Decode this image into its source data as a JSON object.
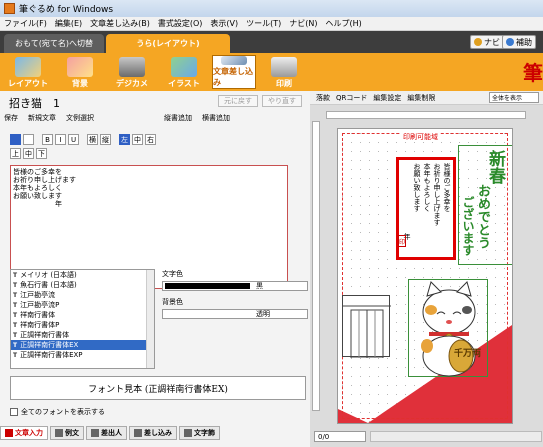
{
  "window": {
    "title": "筆ぐるめ for Windows"
  },
  "menu": [
    "ファイル(F)",
    "編集(E)",
    "文章差し込み(B)",
    "書式設定(O)",
    "表示(V)",
    "ツール(T)",
    "ナビ(N)",
    "ヘルプ(H)"
  ],
  "tabs": {
    "front": "おもて(宛て名)へ切替",
    "back": "うら(レイアウト)"
  },
  "help_buttons": {
    "navi": "ナビ",
    "assist": "補助"
  },
  "ribbon": [
    "レイアウト",
    "背景",
    "デジカメ",
    "イラスト",
    "文章差し込み",
    "印刷"
  ],
  "brand": "筆",
  "editor": {
    "title": "招き猫　1",
    "undo": "元に戻す",
    "redo": "やり直す",
    "toolbar": {
      "save": "保存",
      "new_text": "新規文章",
      "select_text": "文例選択",
      "add_vertical": "縦書追加",
      "add_horizontal": "横書追加"
    },
    "format_row1": [
      "B",
      "I",
      "U",
      "横",
      "縦",
      "左",
      "中",
      "右"
    ],
    "format_row2": [
      "上",
      "中",
      "下"
    ],
    "body_text": "皆様のご多幸を\nお祈り申し上げます\n本年もよろしく\nお願い致します\n　　　　　　年",
    "fonts": [
      "メイリオ (日本語)",
      "魚石行書 (日本語)",
      "江戸勘亭流",
      "江戸勘亭流P",
      "祥南行書体",
      "祥南行書体P",
      "正調祥南行書体",
      "正調祥南行書体EX",
      "正調祥南行書体EXP"
    ],
    "selected_font_index": 7,
    "text_color_label": "文字色",
    "text_color_name": "黒",
    "text_color_hex": "#000000",
    "bg_color_label": "背景色",
    "bg_color_name": "透明",
    "sample": "フォント見本 (正調祥南行書体EX)",
    "show_all_fonts": "全てのフォントを表示する",
    "bottom_tabs": [
      "文章入力",
      "例文",
      "差出人",
      "差し込み",
      "文字飾"
    ]
  },
  "preview": {
    "toolbar": {
      "stamp": "落款",
      "qr": "QRコード",
      "grid": "編集設定",
      "insert": "編集制限"
    },
    "zoom": "全体を表示",
    "print_label": "印刷可能域",
    "message_columns": [
      "皆様のご多幸を",
      "お祈り申し上げます",
      "本年もよろしく",
      "お願い致します",
      "年"
    ],
    "greeting_big": "新春",
    "greeting_cols": [
      "おめでとう",
      "ございます"
    ],
    "coin_text": "千万両",
    "page": "0/0"
  },
  "colors": {
    "accent": "#f5a623",
    "red": "#e00000",
    "green": "#2a8a2a",
    "selected": "#316ac5"
  }
}
